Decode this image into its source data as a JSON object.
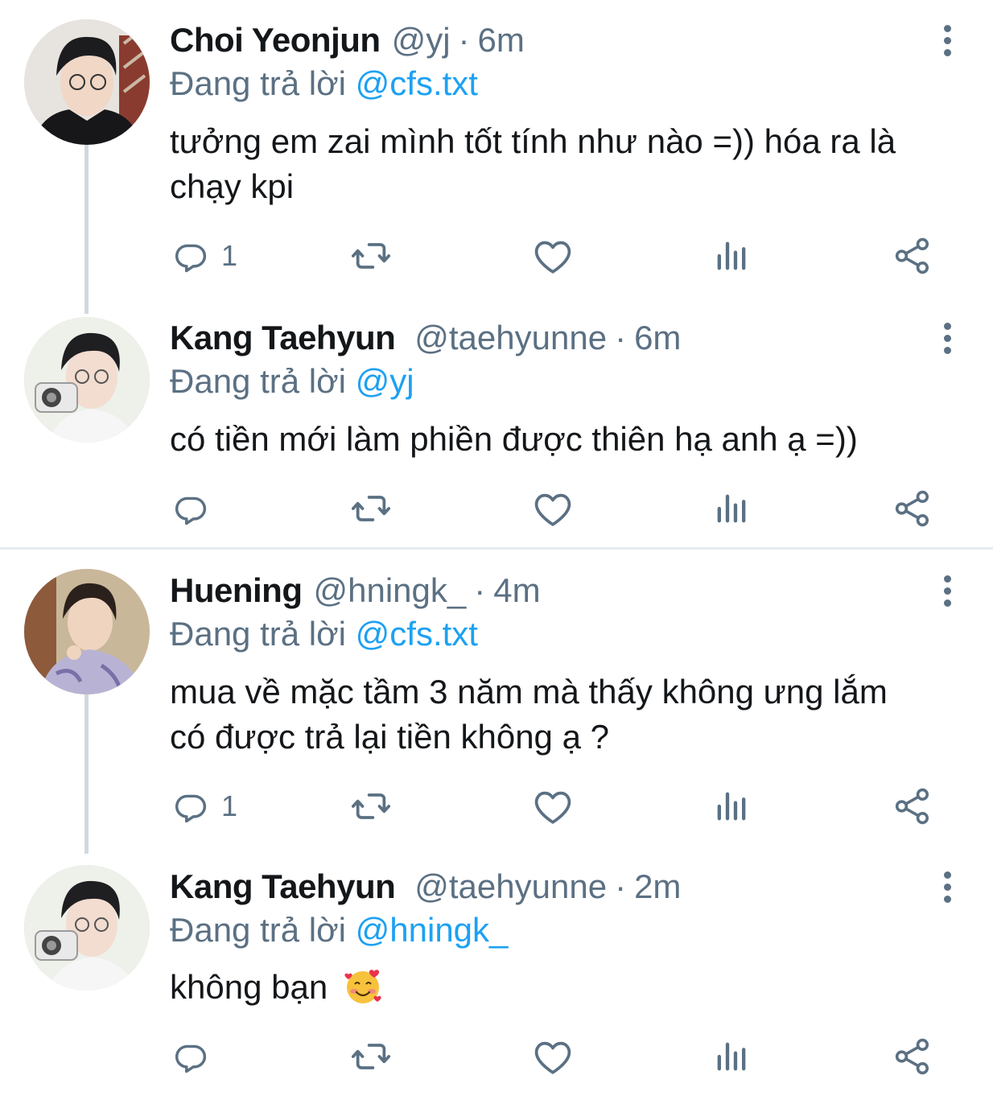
{
  "tweets": [
    {
      "name": "Choi Yeonjun",
      "handle": "@yj",
      "time": "6m",
      "replying_prefix": "Đang trả lời",
      "replying_to": "@cfs.txt",
      "text_line1": "tưởng em zai mình tốt tính như nào =)) hóa ra là",
      "text_line2": "chạy kpi",
      "reply_count": "1"
    },
    {
      "name": "Kang Taehyun",
      "handle": "@taehyunne",
      "time": "6m",
      "replying_prefix": "Đang trả lời",
      "replying_to": "@yj",
      "text_line1": "có tiền mới làm phiền được thiên hạ anh ạ =))",
      "reply_count": ""
    },
    {
      "name": "Huening",
      "handle": "@hningk_",
      "time": "4m",
      "replying_prefix": "Đang trả lời",
      "replying_to": "@cfs.txt",
      "text_line1": "mua về mặc tầm 3 năm mà thấy không ưng lắm",
      "text_line2": "có được trả lại tiền không ạ ?",
      "reply_count": "1"
    },
    {
      "name": "Kang Taehyun",
      "handle": "@taehyunne",
      "time": "2m",
      "replying_prefix": "Đang trả lời",
      "replying_to": "@hningk_",
      "text_line1": "không bạn",
      "emoji": "smiling-face-with-hearts",
      "reply_count": ""
    }
  ],
  "separator": "·",
  "icons": [
    "reply-icon",
    "retweet-icon",
    "like-icon",
    "analytics-icon",
    "share-icon",
    "more-options-icon"
  ],
  "colors": {
    "text": "#14171a",
    "secondary": "#5b7083",
    "mention": "#1da1f2",
    "thread_line": "#cfd9de",
    "divider": "#e6ecf0"
  }
}
